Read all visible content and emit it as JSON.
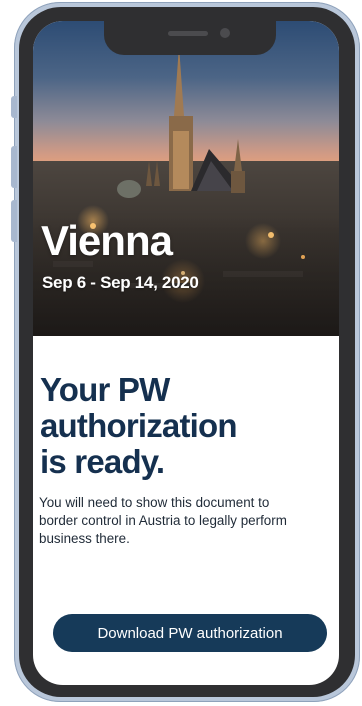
{
  "trip": {
    "city": "Vienna",
    "dates": "Sep 6 - Sep 14, 2020"
  },
  "content": {
    "headline": [
      "Your PW",
      "authorization",
      "is ready."
    ],
    "body": "You will need to show this document to border control in Austria to legally perform business there."
  },
  "actions": {
    "download_label": "Download PW authorization"
  },
  "colors": {
    "primary": "#163a59",
    "headline": "#15304f",
    "frame": "#b9c7da"
  }
}
